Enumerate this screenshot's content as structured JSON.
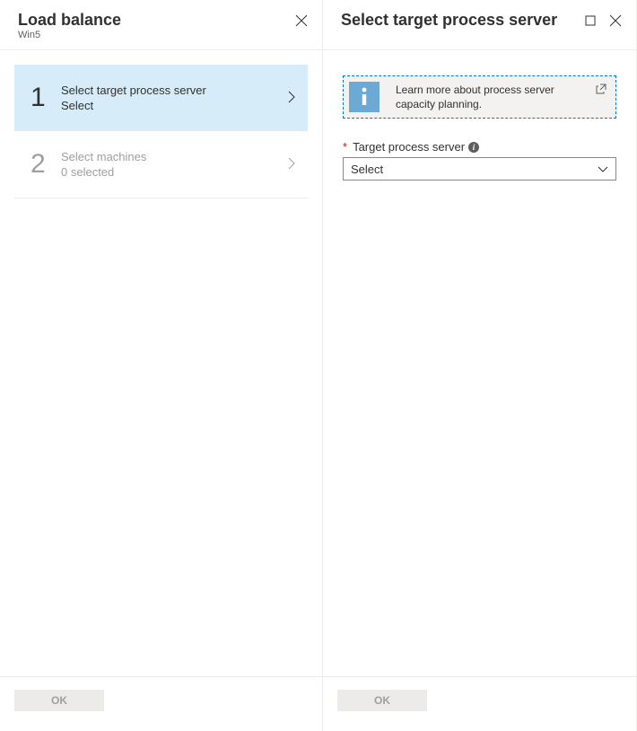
{
  "left": {
    "title": "Load balance",
    "subtitle": "Win5",
    "steps": [
      {
        "num": "1",
        "title": "Select target process server",
        "sub": "Select"
      },
      {
        "num": "2",
        "title": "Select machines",
        "sub": "0 selected"
      }
    ],
    "ok": "OK"
  },
  "right": {
    "title": "Select target process server",
    "info_text": "Learn more about process server capacity planning.",
    "field_label": "Target process server",
    "select_value": "Select",
    "ok": "OK"
  }
}
